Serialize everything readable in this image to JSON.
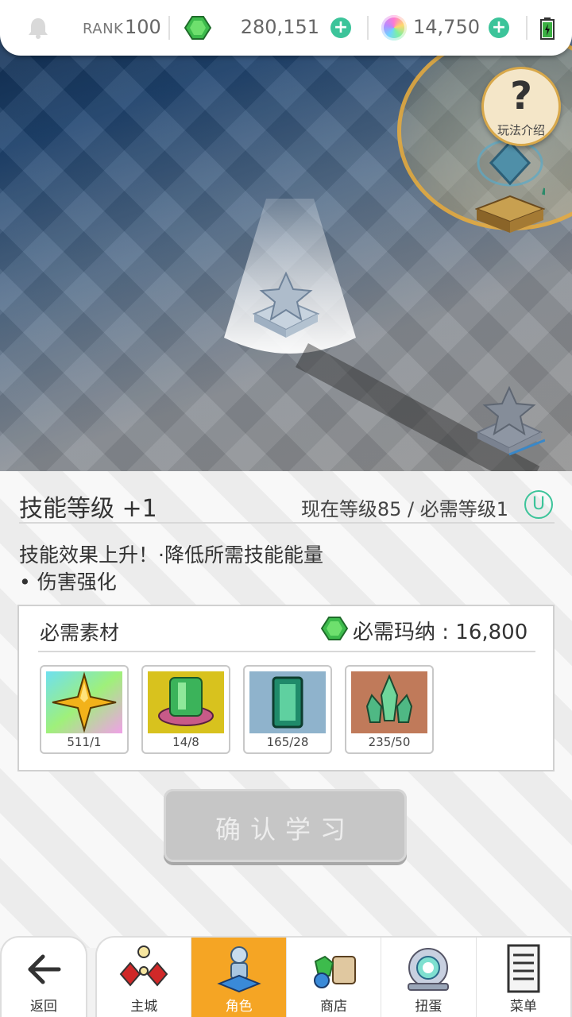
{
  "topbar": {
    "rank_label": "RANK",
    "rank_value": "100",
    "mana_value": "280,151",
    "orb_value": "14,750",
    "icons": [
      "bell-icon",
      "green-gem-icon",
      "rainbow-orb-icon",
      "battery-icon",
      "plus-icon"
    ]
  },
  "game": {
    "help_label": "玩法介绍",
    "help_symbol": "?"
  },
  "panel": {
    "skill_title": "技能等级 +1",
    "level_info": "现在等级85 / 必需等级1",
    "u_symbol": "U",
    "desc_line1": "技能效果上升！·降低所需技能能量",
    "desc_line2": "• 伤害强化",
    "materials": {
      "title": "必需素材",
      "cost_label": "必需玛纳 : 16,800",
      "items": [
        {
          "icon": "golden-star-icon",
          "count": "511/1"
        },
        {
          "icon": "green-hat-icon",
          "count": "14/8"
        },
        {
          "icon": "emerald-gem-icon",
          "count": "165/28"
        },
        {
          "icon": "green-crystal-icon",
          "count": "235/50"
        }
      ]
    },
    "confirm_label": "确认学习"
  },
  "nav": {
    "back_label": "返回",
    "tabs": [
      {
        "label": "主城",
        "icon": "castle-icon"
      },
      {
        "label": "角色",
        "icon": "character-icon"
      },
      {
        "label": "商店",
        "icon": "shop-bag-icon"
      },
      {
        "label": "扭蛋",
        "icon": "gacha-icon"
      },
      {
        "label": "菜单",
        "icon": "menu-list-icon"
      }
    ],
    "active_tab": "角色"
  },
  "colors": {
    "accent_green": "#3cc49a",
    "active_tab": "#f5a524",
    "disabled_button": "#c6c6c6"
  }
}
